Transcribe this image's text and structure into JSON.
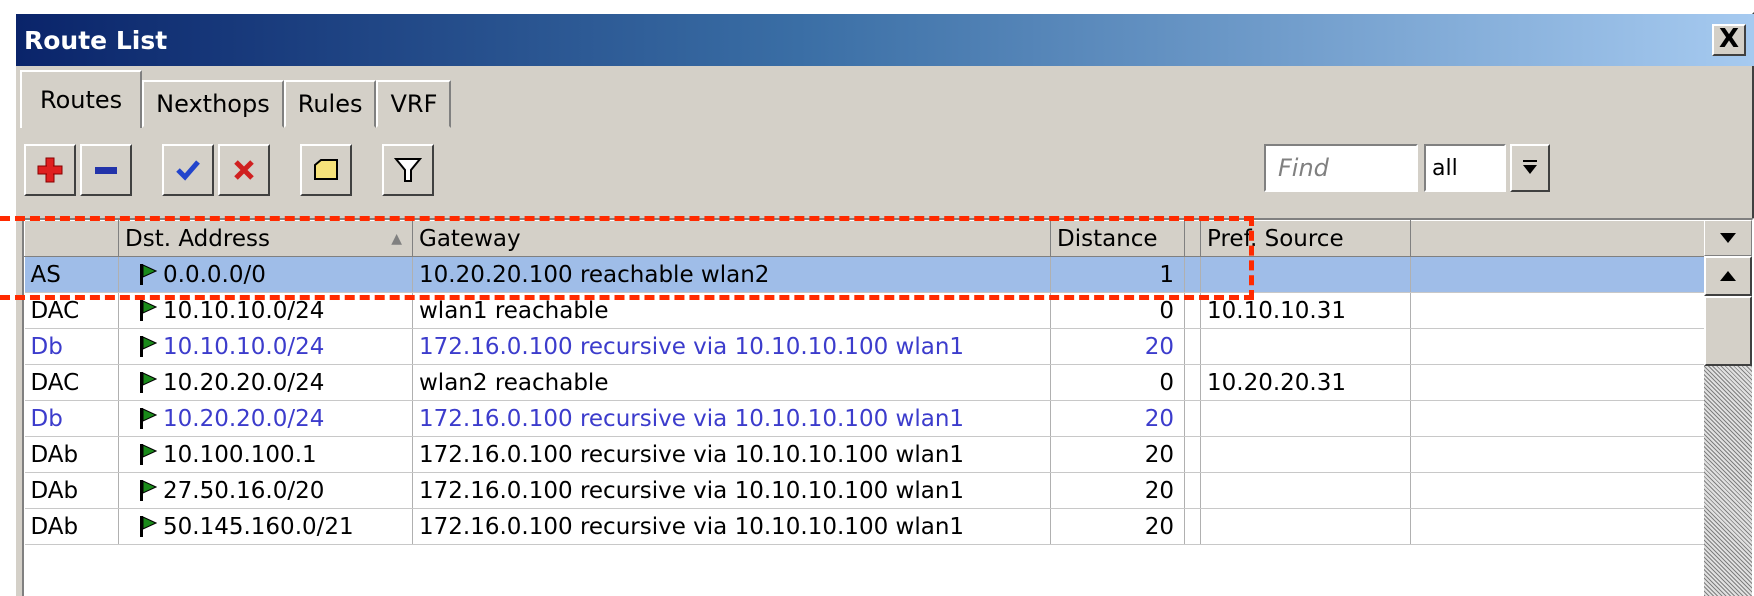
{
  "window": {
    "title": "Route List",
    "close_label": "X"
  },
  "tabs": [
    "Routes",
    "Nexthops",
    "Rules",
    "VRF"
  ],
  "toolbar": {
    "buttons": [
      {
        "icon": "plus-icon"
      },
      {
        "icon": "minus-icon"
      },
      {
        "icon": "check-icon"
      },
      {
        "icon": "cross-icon"
      },
      {
        "icon": "comment-icon"
      },
      {
        "icon": "filter-icon"
      }
    ],
    "find_placeholder": "Find",
    "filter_value": "all"
  },
  "table": {
    "columns": [
      "",
      "Dst. Address",
      "Gateway",
      "Distance",
      "Pref. Source",
      ""
    ],
    "rows": [
      {
        "flags": "AS",
        "dst": "0.0.0.0/0",
        "gateway": "10.20.20.100 reachable wlan2",
        "distance": "1",
        "pref_source": "",
        "style": "selected"
      },
      {
        "flags": "DAC",
        "dst": "10.10.10.0/24",
        "gateway": "wlan1 reachable",
        "distance": "0",
        "pref_source": "10.10.10.31",
        "style": "normal"
      },
      {
        "flags": "Db",
        "dst": "10.10.10.0/24",
        "gateway": "172.16.0.100 recursive via 10.10.10.100 wlan1",
        "distance": "20",
        "pref_source": "",
        "style": "blue"
      },
      {
        "flags": "DAC",
        "dst": "10.20.20.0/24",
        "gateway": "wlan2 reachable",
        "distance": "0",
        "pref_source": "10.20.20.31",
        "style": "normal"
      },
      {
        "flags": "Db",
        "dst": "10.20.20.0/24",
        "gateway": "172.16.0.100 recursive via 10.10.10.100 wlan1",
        "distance": "20",
        "pref_source": "",
        "style": "blue"
      },
      {
        "flags": "DAb",
        "dst": "10.100.100.1",
        "gateway": "172.16.0.100 recursive via 10.10.10.100 wlan1",
        "distance": "20",
        "pref_source": "",
        "style": "normal"
      },
      {
        "flags": "DAb",
        "dst": "27.50.16.0/20",
        "gateway": "172.16.0.100 recursive via 10.10.10.100 wlan1",
        "distance": "20",
        "pref_source": "",
        "style": "normal"
      },
      {
        "flags": "DAb",
        "dst": "50.145.160.0/21",
        "gateway": "172.16.0.100 recursive via 10.10.10.100 wlan1",
        "distance": "20",
        "pref_source": "",
        "style": "normal"
      }
    ]
  },
  "colors": {
    "highlight": "#ff2a00",
    "selected_row": "#9fbde8",
    "blue_text": "#3c3ccc",
    "flag_green": "#1a8a1a"
  }
}
